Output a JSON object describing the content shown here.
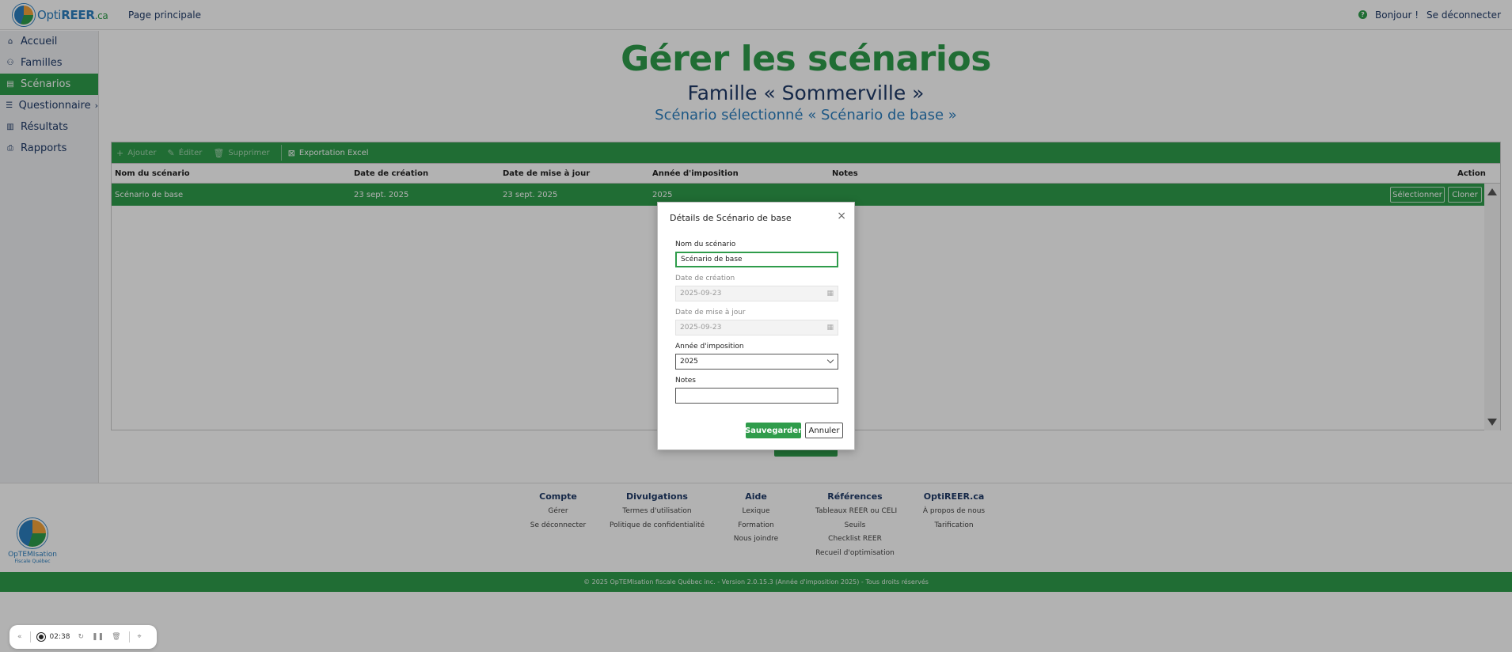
{
  "header": {
    "brand_part1": "Opti",
    "brand_part2": "REER",
    "brand_part3": ".ca",
    "home_link": "Page principale",
    "greeting": "Bonjour !",
    "logout": "Se déconnecter",
    "help": "?"
  },
  "sidebar": {
    "items": [
      {
        "label": "Accueil",
        "icon": "home-icon"
      },
      {
        "label": "Familles",
        "icon": "family-icon"
      },
      {
        "label": "Scénarios",
        "icon": "scenario-icon"
      },
      {
        "label": "Questionnaire",
        "icon": "questionnaire-icon"
      },
      {
        "label": "Résultats",
        "icon": "chart-icon"
      },
      {
        "label": "Rapports",
        "icon": "report-icon"
      }
    ],
    "active_index": 2
  },
  "main": {
    "title": "Gérer les scénarios",
    "subtitle": "Famille « Sommerville »",
    "subtitle2": "Scénario sélectionné « Scénario de base »",
    "toolbar": {
      "add": "Ajouter",
      "edit": "Éditer",
      "delete": "Supprimer",
      "export": "Exportation Excel"
    },
    "columns": [
      "Nom du scénario",
      "Date de création",
      "Date de mise à jour",
      "Année d'imposition",
      "Notes",
      "Action"
    ],
    "rows": [
      {
        "name": "Scénario de base",
        "created": "23 sept. 2025",
        "updated": "23 sept. 2025",
        "year": "2025",
        "notes": "",
        "select": "Sélectionner",
        "clone": "Cloner"
      }
    ]
  },
  "modal": {
    "title": "Détails de Scénario de base",
    "name_label": "Nom du scénario",
    "name_value": "Scénario de base",
    "created_label": "Date de création",
    "created_value": "2025-09-23",
    "updated_label": "Date de mise à jour",
    "updated_value": "2025-09-23",
    "year_label": "Année d'imposition",
    "year_value": "2025",
    "notes_label": "Notes",
    "notes_value": "",
    "save": "Sauvegarder",
    "cancel": "Annuler"
  },
  "footer": {
    "logo_text": "OpTEMIsation",
    "logo_sub": "Fiscale Québec",
    "cols": [
      {
        "heading": "Compte",
        "links": [
          "Gérer",
          "Se déconnecter"
        ]
      },
      {
        "heading": "Divulgations",
        "links": [
          "Termes d'utilisation",
          "Politique de confidentialité"
        ]
      },
      {
        "heading": "Aide",
        "links": [
          "Lexique",
          "Formation",
          "Nous joindre"
        ]
      },
      {
        "heading": "Références",
        "links": [
          "Tableaux REER ou CELI",
          "Seuils",
          "Checklist REER",
          "Recueil d'optimisation"
        ]
      },
      {
        "heading": "OptiREER.ca",
        "links": [
          "À propos de nous",
          "Tarification"
        ]
      }
    ],
    "copyright": "© 2025 OpTEMIsation fiscale Québec inc. - Version 2.0.15.3 (Année d'imposition 2025) - Tous droits réservés"
  },
  "recorder": {
    "time": "02:38"
  },
  "colors": {
    "brand_green": "#2f9c4b",
    "brand_blue": "#2b7fbf",
    "navy": "#1f3a68"
  }
}
